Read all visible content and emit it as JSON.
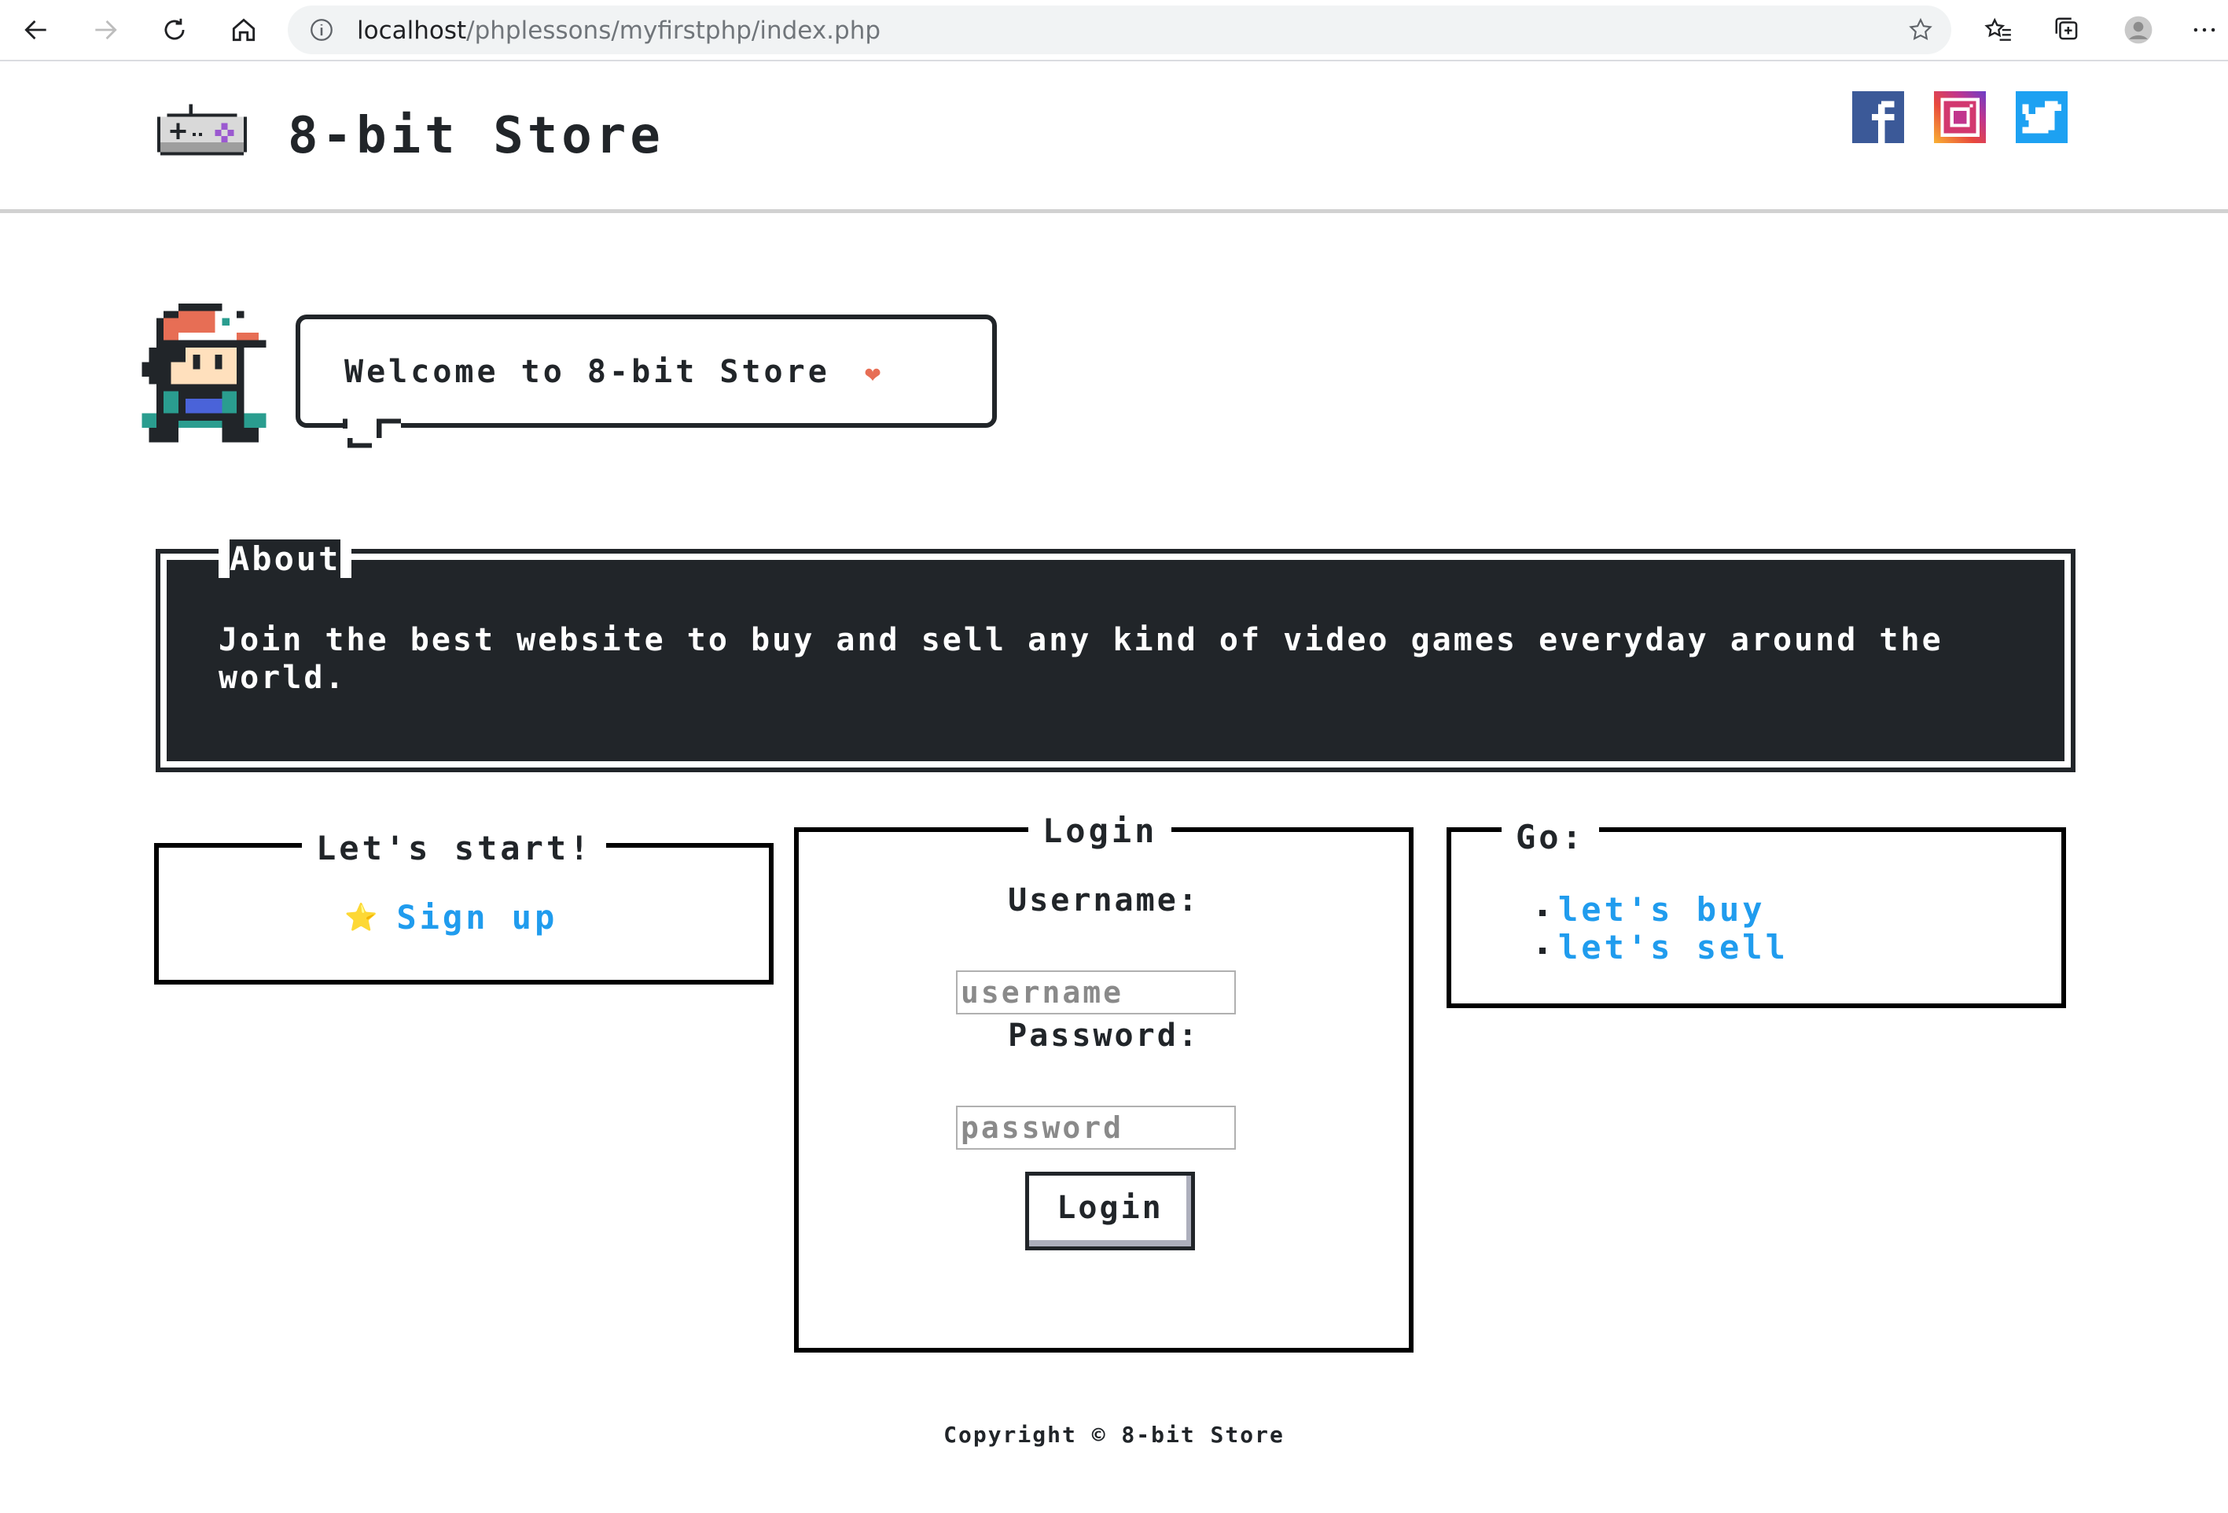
{
  "browser": {
    "url_host": "localhost",
    "url_path": "/phplessons/myfirstphp/index.php"
  },
  "header": {
    "title": "8-bit Store",
    "social": [
      "facebook-icon",
      "instagram-icon",
      "twitter-icon"
    ]
  },
  "hero": {
    "welcome": "Welcome to 8-bit Store",
    "heart": "❤"
  },
  "about": {
    "title": "About",
    "body": "Join the best website to buy and sell any kind of video games everyday around the world."
  },
  "start": {
    "title": "Let's start!",
    "star": "⭐",
    "signup": "Sign up"
  },
  "login": {
    "title": "Login",
    "username_label": "Username:",
    "username_placeholder": "username",
    "password_label": "Password:",
    "password_placeholder": "password",
    "button": "Login"
  },
  "go": {
    "title": "Go:",
    "links": [
      "let's buy",
      "let's sell"
    ]
  },
  "footer": {
    "copyright": "Copyright © 8-bit Store"
  },
  "colors": {
    "link": "#209cee",
    "dark": "#212529",
    "heart": "#e76e55"
  }
}
